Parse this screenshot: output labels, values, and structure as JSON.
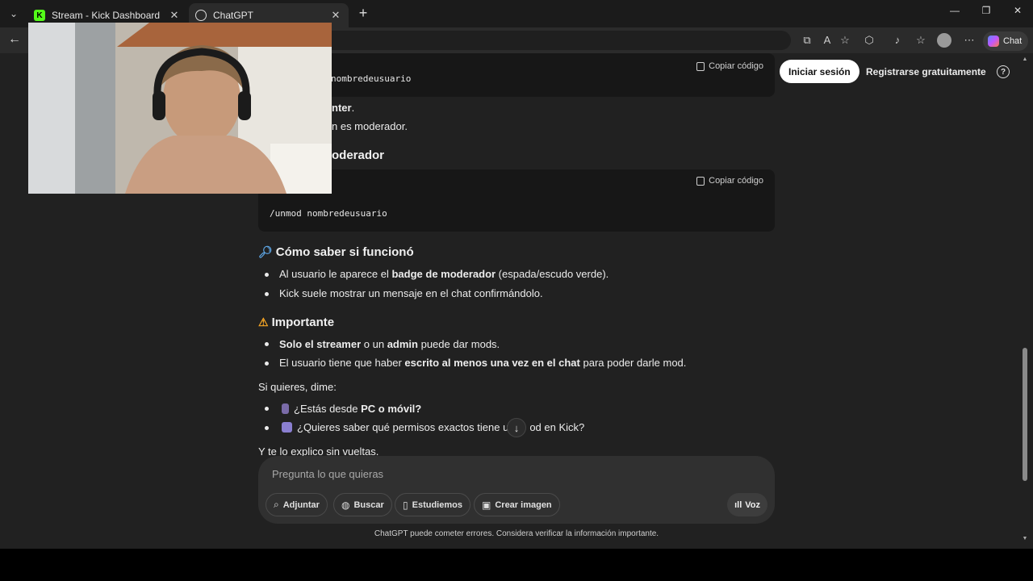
{
  "browser": {
    "tabs": [
      {
        "title": "Stream - Kick Dashboard",
        "favicon": "K",
        "favicon_color": "#53fc18",
        "active": false
      },
      {
        "title": "ChatGPT",
        "favicon": "openai-icon",
        "active": true
      }
    ]
  },
  "header": {
    "login_label": "Iniciar sesión",
    "signup_label": "Registrarse gratuitamente",
    "copilot_label": "Chat"
  },
  "code_blocks": [
    {
      "copy_label": "Copiar código",
      "code": "nombredeusuario"
    },
    {
      "copy_label": "Copiar código",
      "code": "/unmod nombredeusuario"
    }
  ],
  "content": {
    "line_enter_bold": "nter",
    "line_enter_rest": ".",
    "line_moderator": "n es moderador.",
    "heading_unmod": "oderador",
    "section_check": {
      "title": "Cómo saber si funcionó",
      "icon": "magnifier-icon",
      "items": [
        {
          "pre": "Al usuario le aparece el ",
          "bold": "badge de moderador",
          "post": " (espada/escudo verde)."
        },
        {
          "pre": "Kick suele mostrar un mensaje en el chat confirmándolo.",
          "bold": "",
          "post": ""
        }
      ]
    },
    "section_important": {
      "title": "Importante",
      "icon": "warning-icon",
      "item1": {
        "bold1": "Solo el streamer",
        "mid": " o un ",
        "bold2": "admin",
        "post": " puede dar mods."
      },
      "item2": {
        "pre": "El usuario tiene que haber ",
        "bold": "escrito al menos una vez en el chat",
        "post": " para poder darle mod."
      }
    },
    "ask_intro": "Si quieres, dime:",
    "questions": [
      {
        "pre": "¿Estás desde ",
        "bold": "PC o móvil?",
        "post": "",
        "icon": "phone-icon",
        "icon_color": "#7a6ba8"
      },
      {
        "pre": "¿Quieres saber qué permisos exactos tiene u",
        "bold": "",
        "post": "od en Kick?",
        "icon": "keypad-icon",
        "icon_color": "#8a7fd0"
      }
    ],
    "closing": "Y te lo explico sin vueltas."
  },
  "composer": {
    "placeholder": "Pregunta lo que quieras",
    "buttons": [
      "Adjuntar",
      "Buscar",
      "Estudiemos",
      "Crear imagen"
    ],
    "voice_label": "Voz"
  },
  "disclaimer": "ChatGPT puede cometer errores. Considera verificar la información importante.",
  "colors": {
    "background": "#212121",
    "code_background": "#171717",
    "composer_background": "#303030",
    "kick_green": "#53fc18",
    "warning": "#f5a524"
  }
}
